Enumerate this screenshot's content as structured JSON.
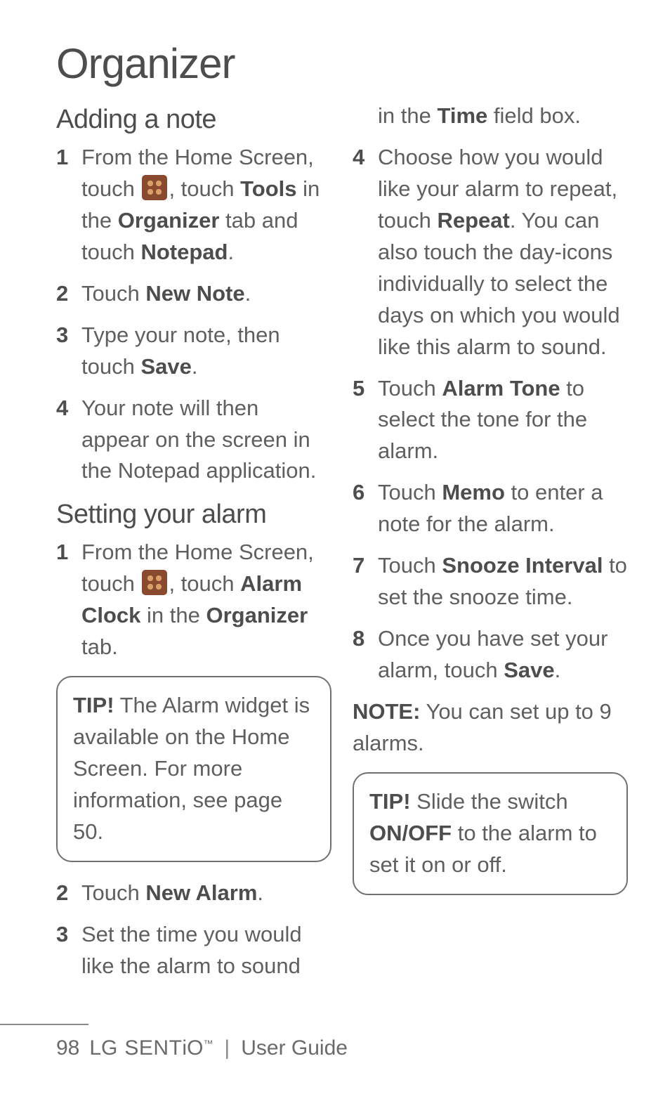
{
  "page_title": "Organizer",
  "left": {
    "adding_note_heading": "Adding a note",
    "steps_a": {
      "s1_pre": "From the Home Screen, touch ",
      "s1_mid": ", touch ",
      "s1_tools": "Tools",
      "s1_inthe": " in the ",
      "s1_org": "Organizer",
      "s1_tab": " tab and touch ",
      "s1_notepad": "Notepad",
      "s1_end": ".",
      "s2_pre": "Touch ",
      "s2_b": "New Note",
      "s2_end": ".",
      "s3_pre": "Type your note, then touch ",
      "s3_b": "Save",
      "s3_end": ".",
      "s4": "Your note will then appear on the screen in the Notepad application."
    },
    "setting_alarm_heading": "Setting your alarm",
    "steps_b": {
      "s1_pre": "From the Home Screen, touch ",
      "s1_mid": ", touch ",
      "s1_alarm": "Alarm Clock",
      "s1_inthe": " in the ",
      "s1_org": "Organizer",
      "s1_tab": " tab."
    },
    "tip1_lead": "TIP!",
    "tip1_body": " The Alarm widget is available on the Home Screen. For more information, see page 50.",
    "steps_c": {
      "s2_pre": "Touch ",
      "s2_b": "New Alarm",
      "s2_end": ".",
      "s3": "Set the time you would like the alarm to sound"
    }
  },
  "right": {
    "cont3_pre": "in the ",
    "cont3_b": "Time",
    "cont3_end": " field box.",
    "s4_pre": "Choose how you would like your alarm to repeat, touch ",
    "s4_b": "Repeat",
    "s4_end": ". You can also touch the day-icons individually to select the days on which you would like this alarm to sound.",
    "s5_pre": "Touch ",
    "s5_b": "Alarm Tone",
    "s5_end": " to select the tone for the alarm.",
    "s6_pre": "Touch ",
    "s6_b": "Memo",
    "s6_end": " to enter a note for the alarm.",
    "s7_pre": "Touch ",
    "s7_b": "Snooze Interval",
    "s7_end": " to set the snooze time.",
    "s8_pre": "Once you have set your alarm, touch ",
    "s8_b": "Save",
    "s8_end": ".",
    "note_lead": "NOTE:",
    "note_body": " You can set up to 9 alarms.",
    "tip2_lead": "TIP!",
    "tip2_a": " Slide the switch ",
    "tip2_b": "ON/OFF",
    "tip2_c": " to the alarm to set it on or off."
  },
  "footer": {
    "page": "98",
    "lg": "LG",
    "brand_a": "SENT",
    "brand_b": "iO",
    "tm": "™",
    "sep": "|",
    "guide": "User Guide"
  }
}
